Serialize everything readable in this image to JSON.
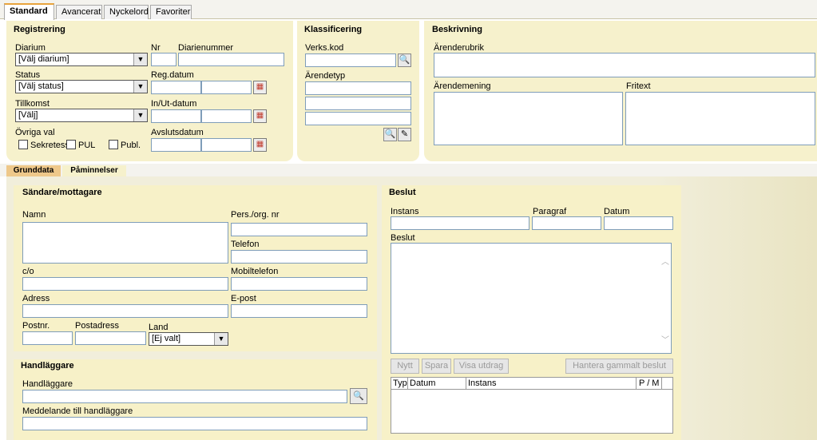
{
  "top_tabs": [
    "Standard",
    "Avancerat",
    "Nyckelord",
    "Favoriter"
  ],
  "registrering": {
    "title": "Registrering",
    "diarium_label": "Diarium",
    "diarium_value": "[Välj diarium]",
    "nr_label": "Nr",
    "diarienummer_label": "Diarienummer",
    "status_label": "Status",
    "status_value": "[Välj status]",
    "regdatum_label": "Reg.datum",
    "tillkomst_label": "Tillkomst",
    "tillkomst_value": "[Välj]",
    "inut_label": "In/Ut-datum",
    "ovriga_label": "Övriga val",
    "avslut_label": "Avslutsdatum",
    "checkboxes": [
      "Sekretess",
      "PUL",
      "Publ."
    ]
  },
  "klassificering": {
    "title": "Klassificering",
    "verks_label": "Verks.kod",
    "arendetyp_label": "Ärendetyp"
  },
  "beskrivning": {
    "title": "Beskrivning",
    "rubrik_label": "Ärenderubrik",
    "mening_label": "Ärendemening",
    "fritext_label": "Fritext"
  },
  "sub_tabs": [
    "Grunddata",
    "Påminnelser"
  ],
  "sandare": {
    "title": "Sändare/mottagare",
    "namn_label": "Namn",
    "pers_label": "Pers./org. nr",
    "telefon_label": "Telefon",
    "co_label": "c/o",
    "mobil_label": "Mobiltelefon",
    "adress_label": "Adress",
    "epost_label": "E-post",
    "postnr_label": "Postnr.",
    "postadress_label": "Postadress",
    "land_label": "Land",
    "land_value": "[Ej valt]"
  },
  "handlaggare": {
    "title": "Handläggare",
    "handl_label": "Handläggare",
    "meddelande_label": "Meddelande till handläggare"
  },
  "beslut": {
    "title": "Beslut",
    "instans_label": "Instans",
    "paragraf_label": "Paragraf",
    "datum_label": "Datum",
    "beslut_label": "Beslut",
    "buttons": [
      "Nytt",
      "Spara",
      "Visa utdrag",
      "Hantera gammalt beslut"
    ],
    "table_headers": [
      "Typ",
      "Datum",
      "Instans",
      "P / M"
    ]
  }
}
